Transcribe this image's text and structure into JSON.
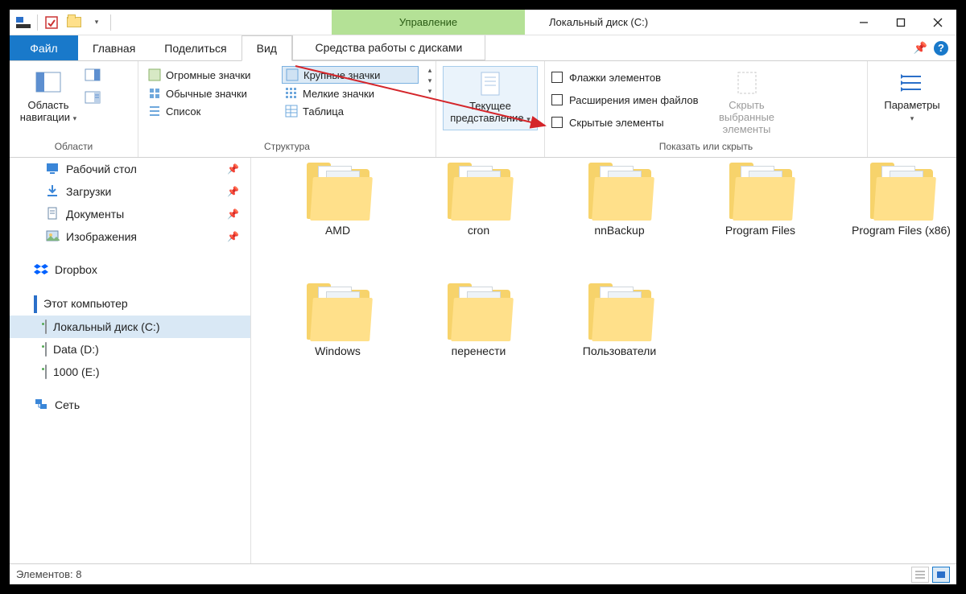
{
  "title": "Локальный диск (C:)",
  "context_tab_header": "Управление",
  "context_tab": "Средства работы с дисками",
  "tabs": {
    "file": "Файл",
    "home": "Главная",
    "share": "Поделиться",
    "view": "Вид"
  },
  "ribbon": {
    "panes_group_label": "Области",
    "nav_pane_label": "Область навигации",
    "layout_group_label": "Структура",
    "layouts": {
      "xl": "Огромные значки",
      "lg": "Крупные значки",
      "md": "Обычные значки",
      "sm": "Мелкие значки",
      "list": "Список",
      "table": "Таблица"
    },
    "current_view_label": "Текущее представление",
    "show_hide_group_label": "Показать или скрыть",
    "chk_item_checkboxes": "Флажки элементов",
    "chk_file_ext": "Расширения имен файлов",
    "chk_hidden": "Скрытые элементы",
    "hide_selected_label": "Скрыть выбранные элементы",
    "options_label": "Параметры"
  },
  "nav": {
    "desktop": "Рабочий стол",
    "downloads": "Загрузки",
    "documents": "Документы",
    "pictures": "Изображения",
    "dropbox": "Dropbox",
    "this_pc": "Этот компьютер",
    "local_c": "Локальный диск (C:)",
    "data_d": "Data (D:)",
    "e_1000": "1000 (E:)",
    "network": "Сеть"
  },
  "folders": [
    {
      "name": "AMD"
    },
    {
      "name": "cron"
    },
    {
      "name": "nnBackup"
    },
    {
      "name": "Program Files"
    },
    {
      "name": "Program Files (x86)"
    },
    {
      "name": "Windows"
    },
    {
      "name": "перенести"
    },
    {
      "name": "Пользователи"
    }
  ],
  "status": {
    "items_label": "Элементов: 8"
  }
}
